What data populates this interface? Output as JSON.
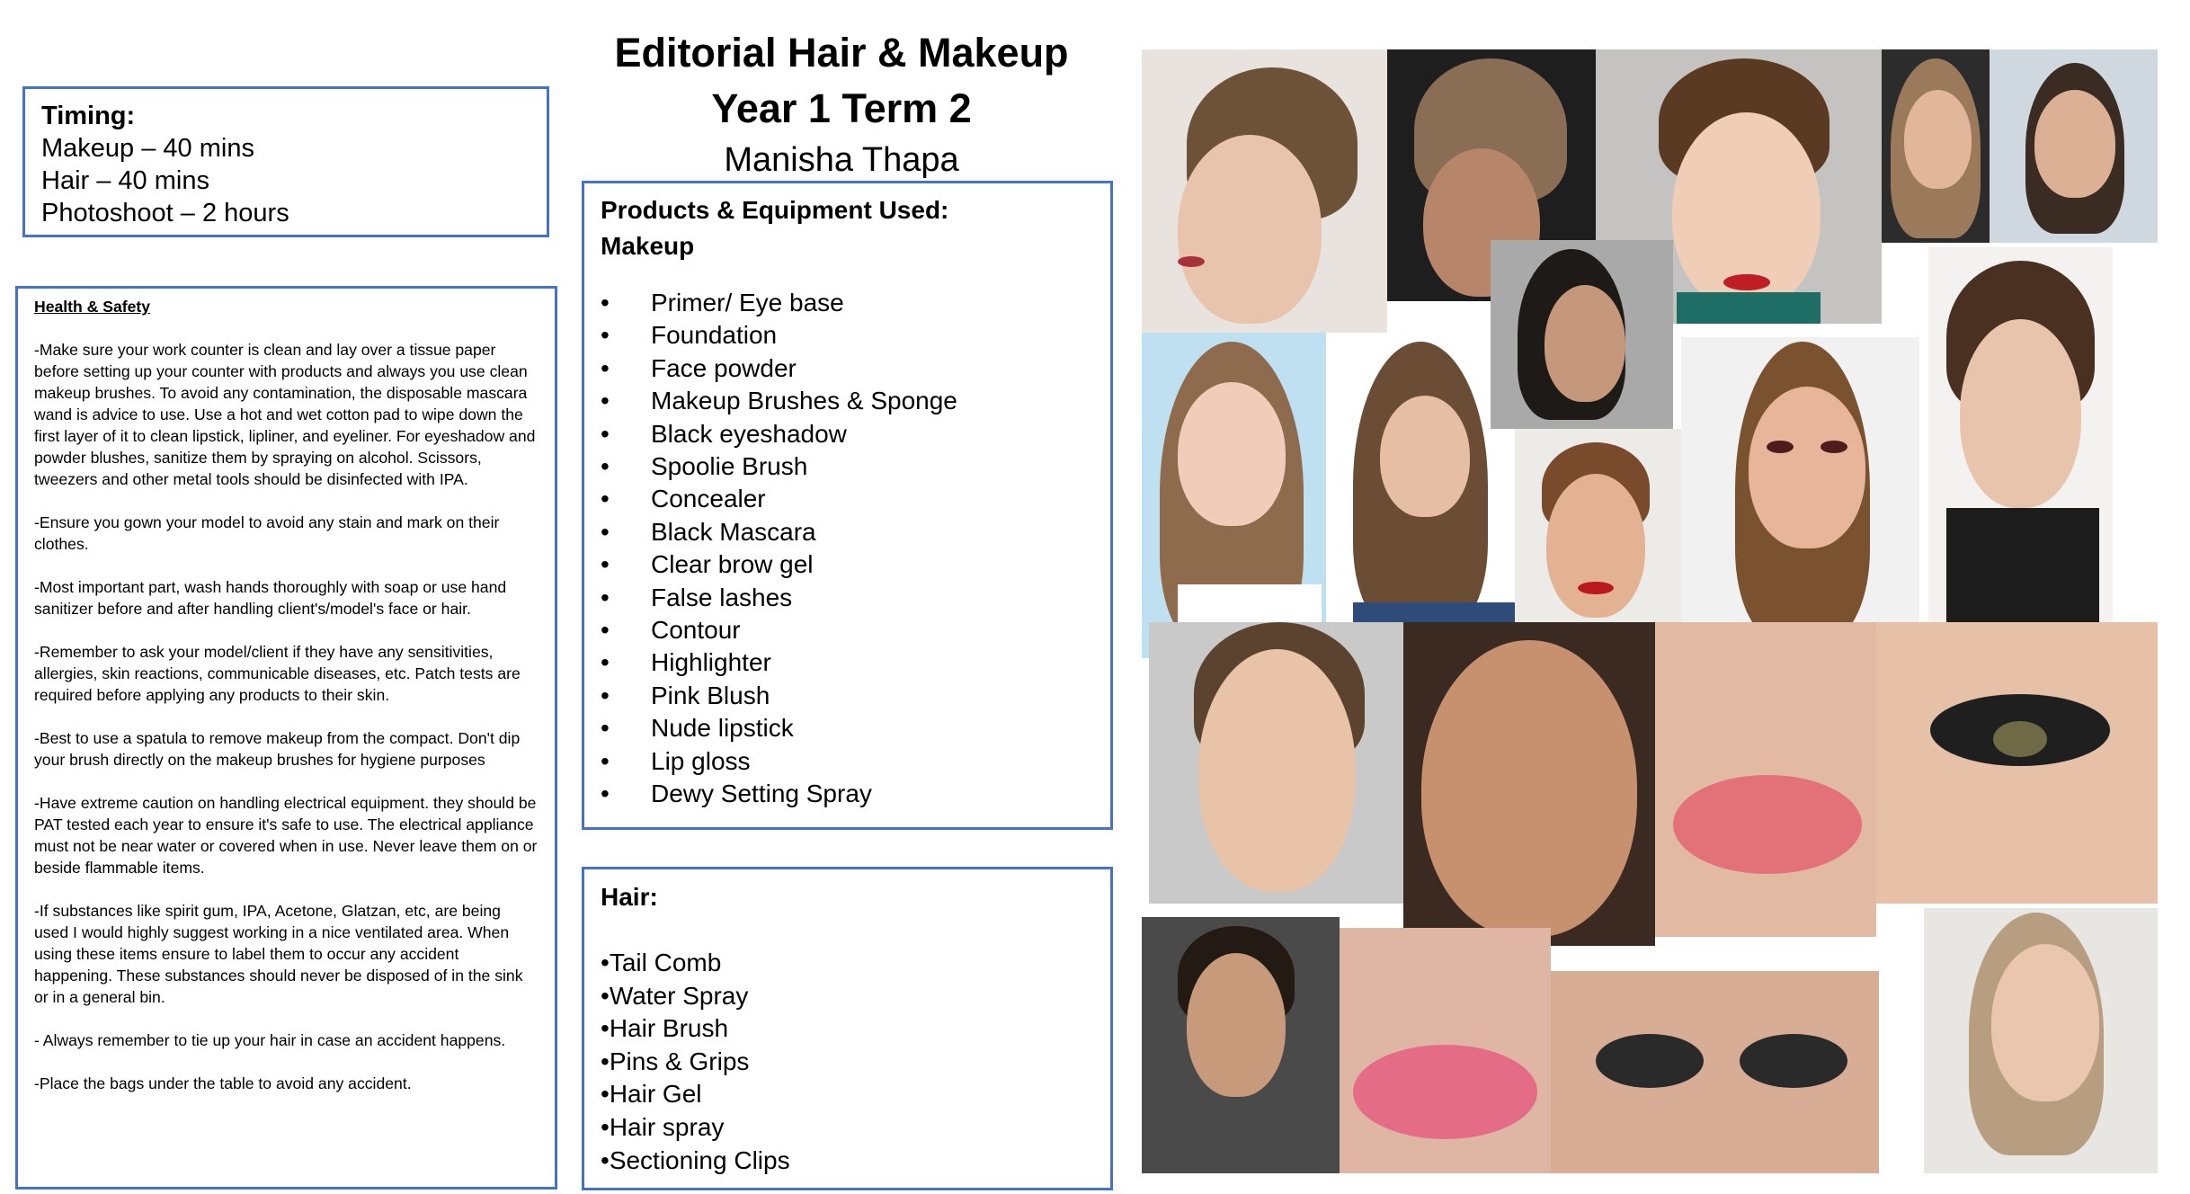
{
  "title": {
    "line1": "Editorial Hair & Makeup",
    "line2": "Year 1 Term 2",
    "author": "Manisha Thapa"
  },
  "timing": {
    "heading": "Timing:",
    "items": [
      "Makeup – 40 mins",
      "Hair – 40 mins",
      "Photoshoot – 2 hours"
    ]
  },
  "health_safety": {
    "heading": "Health & Safety",
    "paragraphs": [
      "-Make sure your work counter is clean and lay over a tissue paper before setting up your counter with products and always you use clean makeup brushes. To avoid any contamination, the disposable mascara wand is advice to use. Use a hot and wet cotton pad to wipe down the first layer of it to clean lipstick, lipliner, and eyeliner. For eyeshadow and powder blushes, sanitize them by spraying on alcohol. Scissors, tweezers and other metal tools should be disinfected with IPA.",
      "-Ensure you gown your model to avoid any stain and mark on their clothes.",
      "-Most important part, wash hands thoroughly with soap or use hand sanitizer before and after handling client's/model's face or hair.",
      "-Remember to ask your model/client if they have any sensitivities, allergies, skin reactions, communicable diseases, etc. Patch tests are required before applying any products to their skin.",
      "-Best to use a spatula to remove makeup from the compact. Don't dip your brush directly on the makeup brushes for hygiene purposes",
      "-Have extreme caution on handling electrical equipment. they should be PAT tested each year to ensure it's safe to use. The electrical appliance must not be near water or covered when in use. Never leave them on or beside flammable items.",
      "-If substances like spirit gum, IPA, Acetone, Glatzan, etc, are being used I would highly suggest working in a nice ventilated area. When using these items ensure to label them to occur any accident happening. These substances should never be disposed of in the sink or in a general bin.",
      "- Always remember to tie up your hair in case an accident happens.",
      "-Place the bags under the table to avoid any accident."
    ]
  },
  "products": {
    "heading": "Products  & Equipment Used:",
    "subheading": "Makeup",
    "items": [
      "Primer/ Eye base",
      "Foundation",
      "Face powder",
      "Makeup Brushes & Sponge",
      "Black eyeshadow",
      "Spoolie Brush",
      "Concealer",
      "Black Mascara",
      "Clear brow gel",
      "False lashes",
      "Contour",
      "Highlighter",
      "Pink Blush",
      "Nude lipstick",
      "Lip gloss",
      "Dewy Setting Spray"
    ]
  },
  "hair": {
    "heading": "Hair:",
    "items": [
      "Tail Comb",
      "Water Spray",
      "Hair Brush",
      "Pins & Grips",
      "Hair Gel",
      "Hair spray",
      "Sectioning Clips"
    ]
  },
  "moodboard": {
    "subjects": [
      "slicked-back-hair",
      "braided-hair",
      "sculpted-fringe",
      "glowing-skin",
      "wet-look-hair",
      "finger-waves",
      "smoky-eye",
      "glossy-lips",
      "dewy-skin",
      "bold-brows"
    ]
  },
  "colors": {
    "accent_border": "#4472c4",
    "text": "#000000",
    "background": "#ffffff"
  }
}
